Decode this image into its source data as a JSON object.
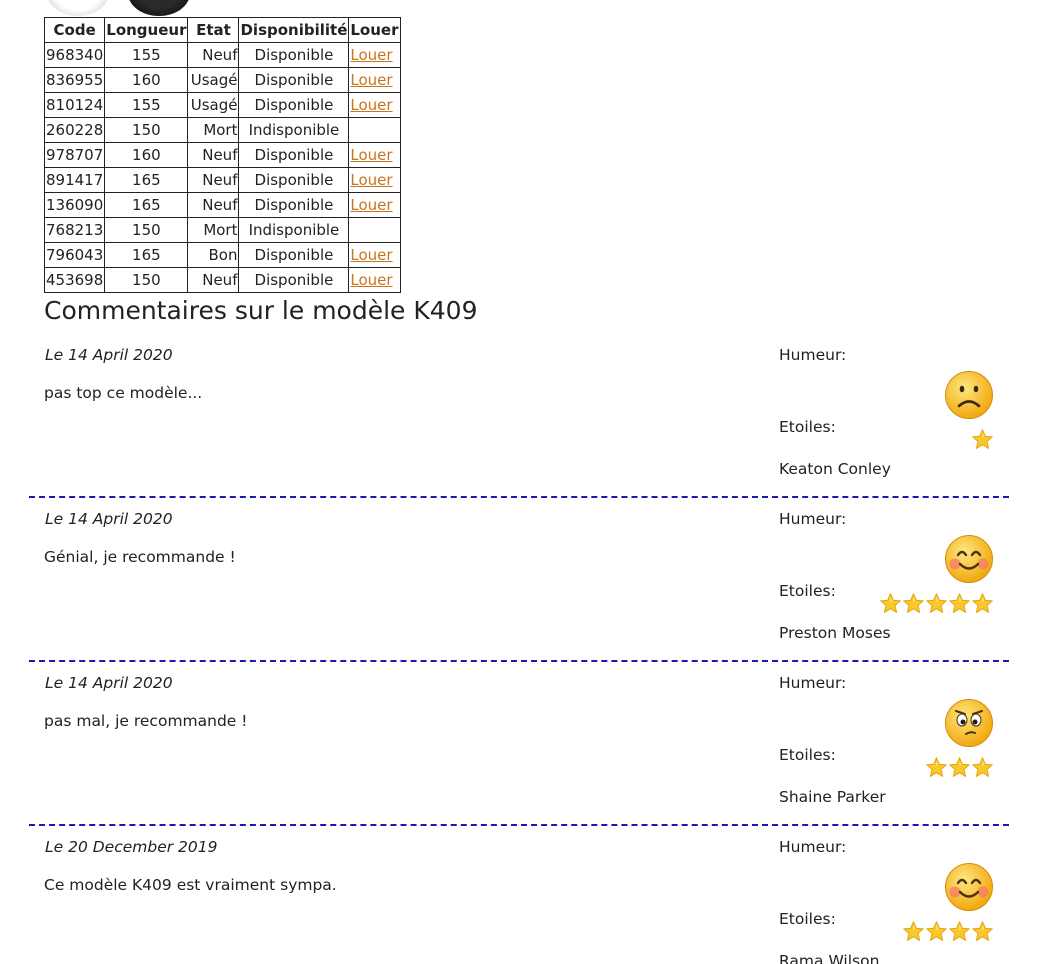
{
  "table": {
    "headers": [
      "Code",
      "Longueur",
      "Etat",
      "Disponibilité",
      "Louer"
    ],
    "rows": [
      {
        "code": "968340",
        "longueur": "155",
        "etat": "Neuf",
        "dispo": "Disponible",
        "louer": "Louer"
      },
      {
        "code": "836955",
        "longueur": "160",
        "etat": "Usagé",
        "dispo": "Disponible",
        "louer": "Louer"
      },
      {
        "code": "810124",
        "longueur": "155",
        "etat": "Usagé",
        "dispo": "Disponible",
        "louer": "Louer"
      },
      {
        "code": "260228",
        "longueur": "150",
        "etat": "Mort",
        "dispo": "Indisponible",
        "louer": ""
      },
      {
        "code": "978707",
        "longueur": "160",
        "etat": "Neuf",
        "dispo": "Disponible",
        "louer": "Louer"
      },
      {
        "code": "891417",
        "longueur": "165",
        "etat": "Neuf",
        "dispo": "Disponible",
        "louer": "Louer"
      },
      {
        "code": "136090",
        "longueur": "165",
        "etat": "Neuf",
        "dispo": "Disponible",
        "louer": "Louer"
      },
      {
        "code": "768213",
        "longueur": "150",
        "etat": "Mort",
        "dispo": "Indisponible",
        "louer": ""
      },
      {
        "code": "796043",
        "longueur": "165",
        "etat": "Bon",
        "dispo": "Disponible",
        "louer": "Louer"
      },
      {
        "code": "453698",
        "longueur": "150",
        "etat": "Neuf",
        "dispo": "Disponible",
        "louer": "Louer"
      }
    ]
  },
  "comments_section": {
    "title": "Commentaires sur le modèle K409",
    "mood_label": "Humeur:",
    "stars_label": "Etoiles:",
    "comments": [
      {
        "date": "Le 14 April 2020",
        "text": "pas top ce modèle...",
        "mood": "sad-face",
        "stars": 1,
        "author": "Keaton Conley"
      },
      {
        "date": "Le 14 April 2020",
        "text": "Génial, je recommande !",
        "mood": "happy-face",
        "stars": 5,
        "author": "Preston Moses"
      },
      {
        "date": "Le 14 April 2020",
        "text": "pas mal, je recommande !",
        "mood": "thinking-face",
        "stars": 3,
        "author": "Shaine Parker"
      },
      {
        "date": "Le 20 December 2019",
        "text": "Ce modèle K409 est vraiment sympa.",
        "mood": "happy-face",
        "stars": 4,
        "author": "Rama Wilson"
      }
    ]
  },
  "colors": {
    "link": "#c8751f",
    "separator": "#1a1ab0",
    "star": "#f5c518",
    "emoji": "#f7c531"
  }
}
